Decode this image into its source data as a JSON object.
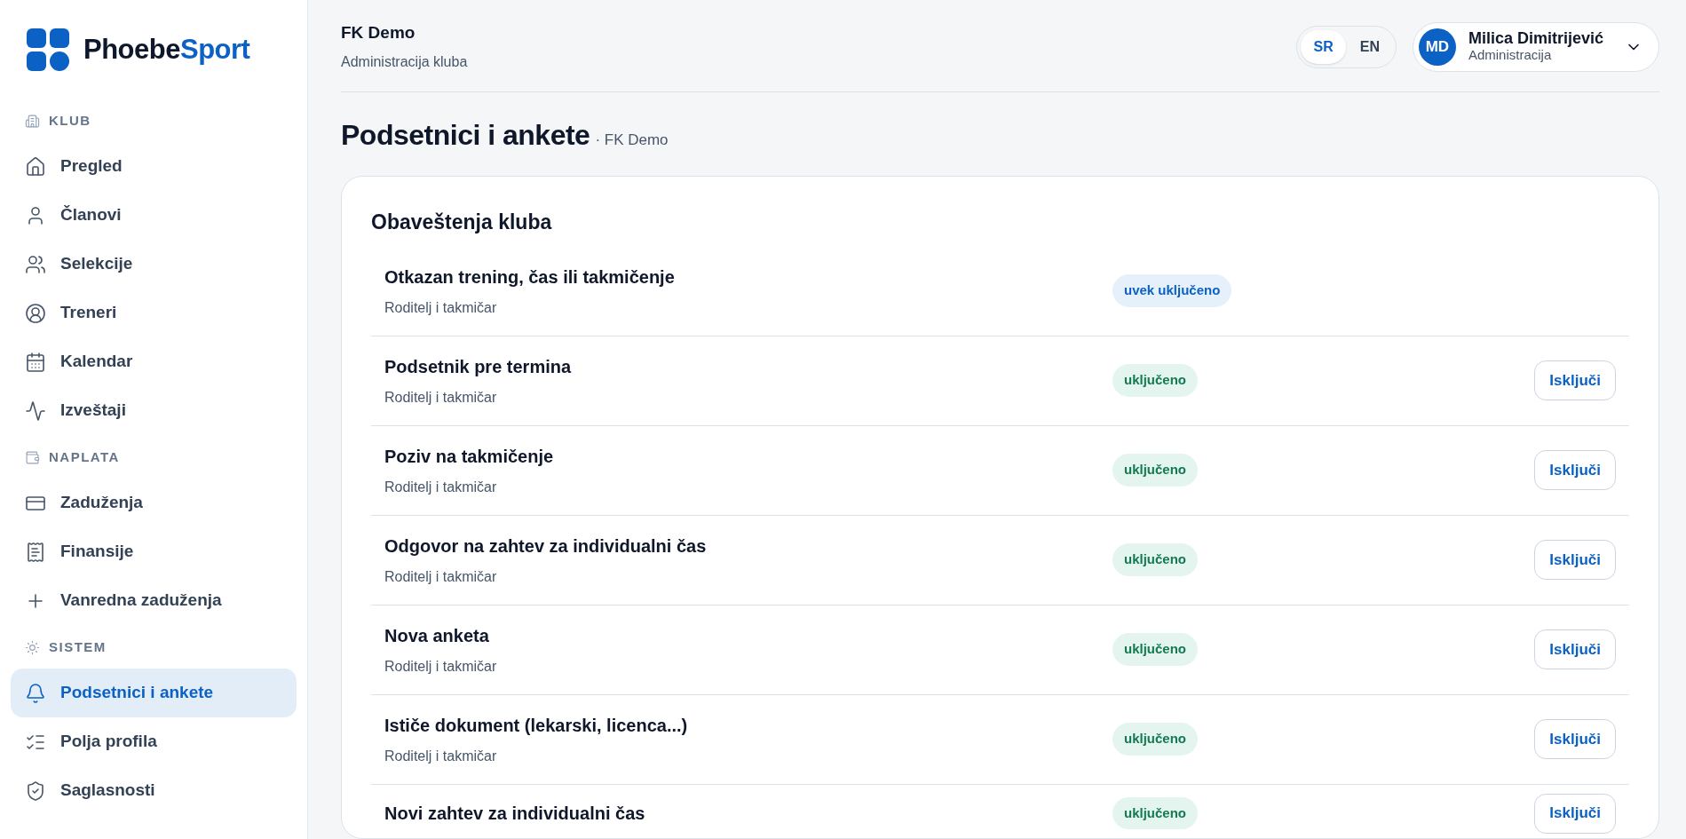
{
  "logo": {
    "part_1": "Phoebe",
    "part_2": "Sport"
  },
  "sidebar": {
    "sections": [
      {
        "title": "KLUB",
        "kind": "building",
        "items": [
          {
            "label": "Pregled",
            "kind": "home",
            "selected": false
          },
          {
            "label": "Članovi",
            "kind": "user",
            "selected": false
          },
          {
            "label": "Selekcije",
            "kind": "users",
            "selected": false
          },
          {
            "label": "Treneri",
            "kind": "user-circle",
            "selected": false
          },
          {
            "label": "Kalendar",
            "kind": "calendar",
            "selected": false
          },
          {
            "label": "Izveštaji",
            "kind": "activity",
            "selected": false
          }
        ]
      },
      {
        "title": "NAPLATA",
        "kind": "wallet",
        "items": [
          {
            "label": "Zaduženja",
            "kind": "card",
            "selected": false
          },
          {
            "label": "Finansije",
            "kind": "receipt",
            "selected": false
          },
          {
            "label": "Vanredna zaduženja",
            "kind": "plus",
            "selected": false
          }
        ]
      },
      {
        "title": "SISTEM",
        "kind": "sun",
        "items": [
          {
            "label": "Podsetnici i ankete",
            "kind": "bell",
            "selected": true
          },
          {
            "label": "Polja profila",
            "kind": "checklist",
            "selected": false
          },
          {
            "label": "Saglasnosti",
            "kind": "shield",
            "selected": false
          }
        ]
      }
    ]
  },
  "header": {
    "club": "FK Demo",
    "subtitle": "Administracija kluba",
    "languages": [
      {
        "label": "SR",
        "selected": true
      },
      {
        "label": "EN",
        "selected": false
      }
    ],
    "user": {
      "initials": "MD",
      "name": "Milica Dimitrijević",
      "role": "Administracija"
    }
  },
  "page": {
    "title": "Podsetnici i ankete",
    "context": "· FK Demo"
  },
  "card": {
    "title": "Obaveštenja kluba",
    "rows": [
      {
        "title": "Otkazan trening, čas ili takmičenje",
        "audience": "Roditelj i takmičar",
        "status": {
          "kind": "always",
          "label": "uvek uključeno"
        }
      },
      {
        "title": "Podsetnik pre termina",
        "audience": "Roditelj i takmičar",
        "status": {
          "kind": "on",
          "label": "uključeno"
        },
        "action": "Isključi"
      },
      {
        "title": "Poziv na takmičenje",
        "audience": "Roditelj i takmičar",
        "status": {
          "kind": "on",
          "label": "uključeno"
        },
        "action": "Isključi"
      },
      {
        "title": "Odgovor na zahtev za individualni čas",
        "audience": "Roditelj i takmičar",
        "status": {
          "kind": "on",
          "label": "uključeno"
        },
        "action": "Isključi"
      },
      {
        "title": "Nova anketa",
        "audience": "Roditelj i takmičar",
        "status": {
          "kind": "on",
          "label": "uključeno"
        },
        "action": "Isključi"
      },
      {
        "title": "Ističe dokument (lekarski, licenca...)",
        "audience": "Roditelj i takmičar",
        "status": {
          "kind": "on",
          "label": "uključeno"
        },
        "action": "Isključi"
      },
      {
        "title": "Novi zahtev za individualni čas",
        "status": {
          "kind": "on",
          "label": "uključeno"
        },
        "action": "Isključi"
      }
    ]
  }
}
